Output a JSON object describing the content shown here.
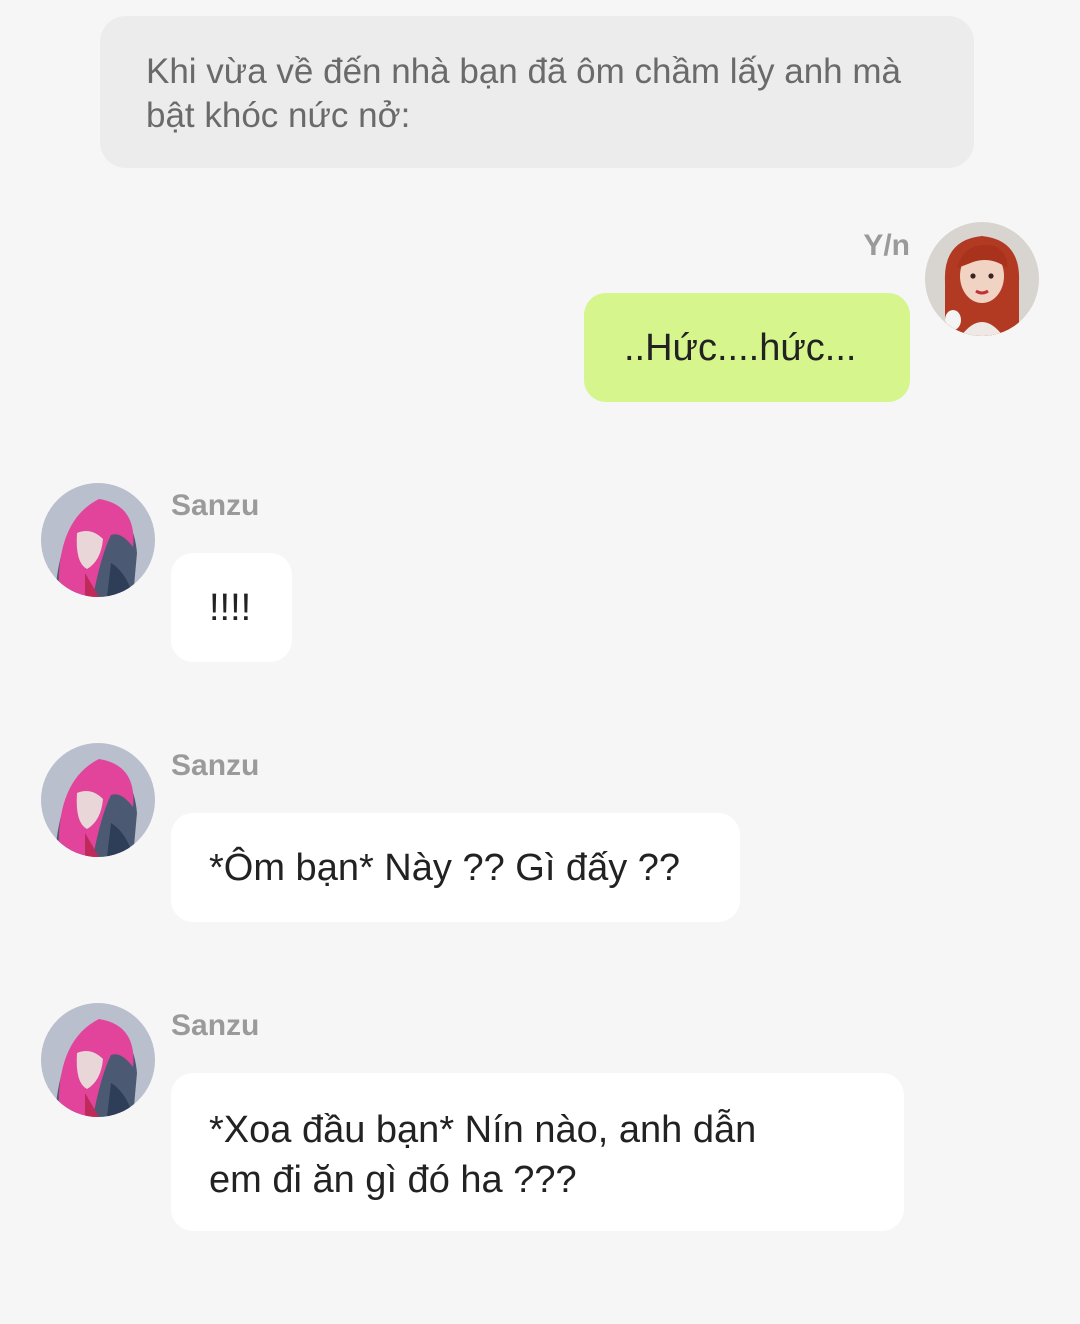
{
  "narration": {
    "line1": "Khi vừa về đến nhà bạn đã ôm chầm lấy anh mà",
    "line2": "bật khóc nức nở:"
  },
  "messages": [
    {
      "sender": "Y/n",
      "lines": [
        "..Hức....hức..."
      ],
      "avatar_icon": "red-haired-girl-avatar"
    },
    {
      "sender": "Sanzu",
      "lines": [
        "!!!!"
      ],
      "avatar_icon": "pink-haired-boy-avatar"
    },
    {
      "sender": "Sanzu",
      "lines": [
        "*Ôm bạn* Này ?? Gì đấy ??"
      ],
      "avatar_icon": "pink-haired-boy-avatar"
    },
    {
      "sender": "Sanzu",
      "lines": [
        "*Xoa đầu bạn* Nín nào, anh dẫn",
        "em đi ăn gì đó ha ???"
      ],
      "avatar_icon": "pink-haired-boy-avatar"
    }
  ],
  "colors": {
    "background": "#f6f6f6",
    "narration_bg": "#ececec",
    "sent_bubble": "#d6f58c",
    "received_bubble": "#ffffff",
    "name_text": "#9a9a9a"
  }
}
